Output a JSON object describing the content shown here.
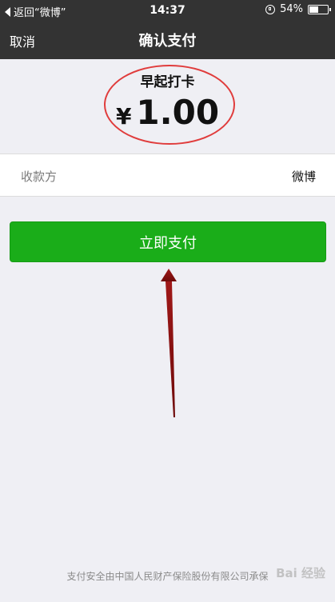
{
  "status_bar": {
    "back_label": "返回“微博”",
    "time": "14:37",
    "battery_percent": "54%",
    "battery_level": 0.54
  },
  "nav": {
    "cancel_label": "取消",
    "title": "确认支付"
  },
  "payment": {
    "merchant": "早起打卡",
    "currency_symbol": "¥",
    "amount": "1.00"
  },
  "payee": {
    "label": "收款方",
    "value": "微博"
  },
  "pay_button": {
    "label": "立即支付"
  },
  "footer": {
    "text": "支付安全由中国人民财产保险股份有限公司承保",
    "watermark": "Bai 经验"
  },
  "colors": {
    "bar_background": "#333333",
    "pay_button": "#1aad19",
    "annotation_circle": "#e03c3c",
    "annotation_arrow": "#8b1010"
  }
}
